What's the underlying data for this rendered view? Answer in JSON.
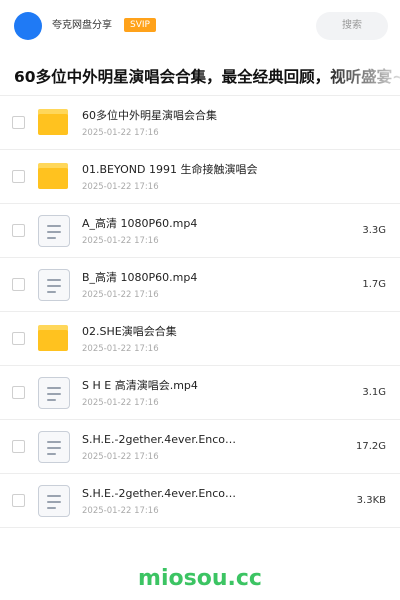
{
  "header": {
    "share_user": "夸克网盘分享",
    "badge": "SVIP",
    "search_label": "搜索"
  },
  "share": {
    "title": "60多位中外明星演唱会合集，最全经典回顾，视听盛宴~"
  },
  "files": [
    {
      "name": "60多位中外明星演唱会合集",
      "date": "2025-01-22 17:16",
      "size": "",
      "type": "folder"
    },
    {
      "name": "01.BEYOND 1991 生命接触演唱会",
      "date": "2025-01-22 17:16",
      "size": "",
      "type": "folder"
    },
    {
      "name": "A_高清 1080P60.mp4",
      "date": "2025-01-22 17:16",
      "size": "3.3G",
      "type": "file"
    },
    {
      "name": "B_高清 1080P60.mp4",
      "date": "2025-01-22 17:16",
      "size": "1.7G",
      "type": "file"
    },
    {
      "name": "02.SHE演唱会合集",
      "date": "2025-01-22 17:16",
      "size": "",
      "type": "folder"
    },
    {
      "name": "S H E 高清演唱会.mp4",
      "date": "2025-01-22 17:16",
      "size": "3.1G",
      "type": "file"
    },
    {
      "name": "S.H.E.-2gether.4ever.Enco…",
      "date": "2025-01-22 17:16",
      "size": "17.2G",
      "type": "file"
    },
    {
      "name": "S.H.E.-2gether.4ever.Enco…",
      "date": "2025-01-22 17:16",
      "size": "3.3KB",
      "type": "file"
    }
  ],
  "icons": {
    "avatar": "avatar-circle",
    "folder": "folder-icon",
    "file": "video-file-icon"
  },
  "colors": {
    "accent": "#1f7af5",
    "badge": "#ffa21a",
    "folder": "#ffc21f",
    "watermark": "#3cc463"
  },
  "watermark": "miosou.cc"
}
